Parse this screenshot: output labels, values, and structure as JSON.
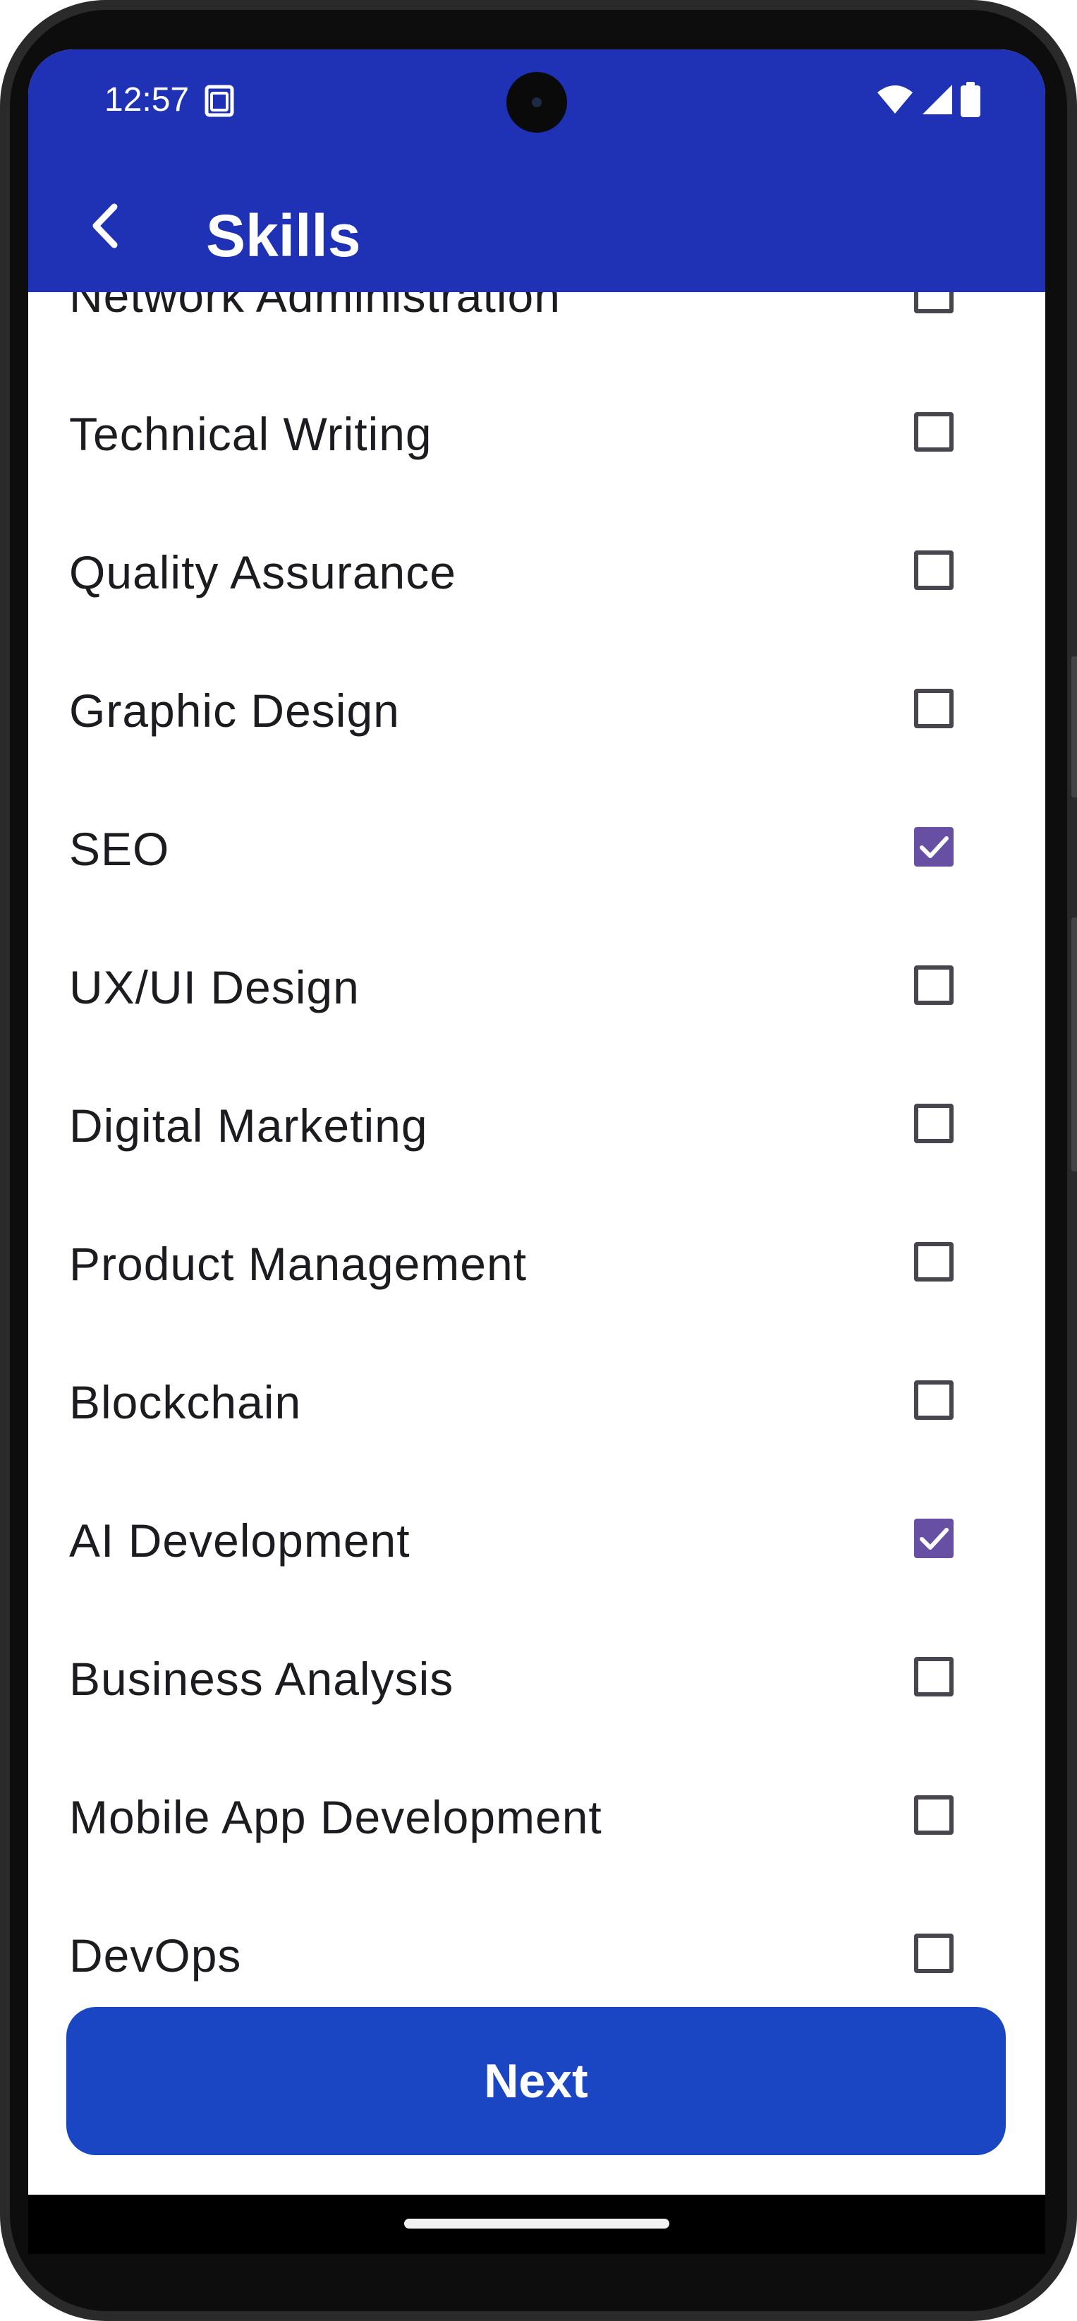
{
  "status_bar": {
    "time": "12:57",
    "sim_icon": "sim-card-icon",
    "wifi_icon": "wifi-icon",
    "signal_icon": "cellular-signal-icon",
    "battery_icon": "battery-icon"
  },
  "app_bar": {
    "title": "Skills",
    "back_icon": "chevron-left-icon",
    "background_color": "#1f31b5"
  },
  "skills": [
    {
      "label": "Network Administration",
      "checked": false
    },
    {
      "label": "Technical Writing",
      "checked": false
    },
    {
      "label": "Quality Assurance",
      "checked": false
    },
    {
      "label": "Graphic Design",
      "checked": false
    },
    {
      "label": "SEO",
      "checked": true
    },
    {
      "label": "UX/UI Design",
      "checked": false
    },
    {
      "label": "Digital Marketing",
      "checked": false
    },
    {
      "label": "Product Management",
      "checked": false
    },
    {
      "label": "Blockchain",
      "checked": false
    },
    {
      "label": "AI Development",
      "checked": true
    },
    {
      "label": "Business Analysis",
      "checked": false
    },
    {
      "label": "Mobile App Development",
      "checked": false
    },
    {
      "label": "DevOps",
      "checked": false
    }
  ],
  "checkbox_checked_color": "#6750a4",
  "next_button": {
    "label": "Next",
    "color": "#1a46c4"
  }
}
